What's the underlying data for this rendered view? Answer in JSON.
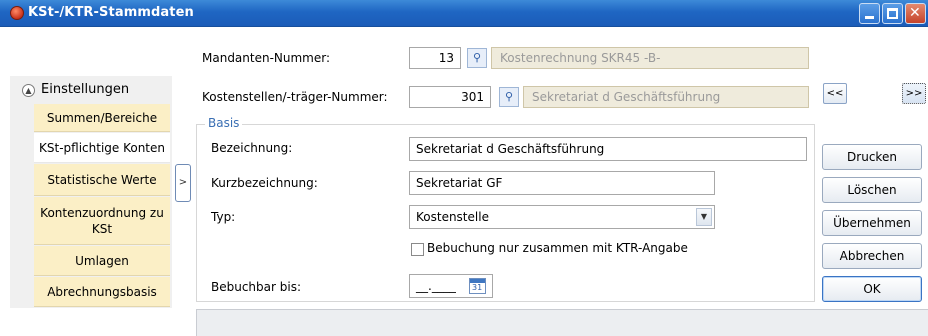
{
  "window": {
    "title": "KSt-/KTR-Stammdaten"
  },
  "sidebar": {
    "header_label": "Einstellungen",
    "items": [
      {
        "label": "Summen/Bereiche"
      },
      {
        "label": "KSt-pflichtige Konten"
      },
      {
        "label": "Statistische Werte"
      },
      {
        "label": "Kontenzuordnung zu KSt"
      },
      {
        "label": "Umlagen"
      },
      {
        "label": "Abrechnungsbasis"
      }
    ],
    "toggle_label": ">"
  },
  "header_fields": {
    "mandant_label": "Mandanten-Nummer:",
    "mandant_value": "13",
    "mandant_name": "Kostenrechnung SKR45 -B-",
    "kst_label": "Kostenstellen/-träger-Nummer:",
    "kst_value": "301",
    "kst_name": "Sekretariat d Geschäftsführung"
  },
  "basis": {
    "group_title": "Basis",
    "bezeichnung_label": "Bezeichnung:",
    "bezeichnung_value": "Sekretariat d Geschäftsführung",
    "kurz_label": "Kurzbezeichnung:",
    "kurz_value": "Sekretariat GF",
    "typ_label": "Typ:",
    "typ_value": "Kostenstelle",
    "checkbox_label": "Bebuchung nur zusammen mit KTR-Angabe",
    "checkbox_checked": false,
    "bebuchbar_label": "Bebuchbar bis:",
    "bebuchbar_value": "__.____",
    "calendar_day": "31"
  },
  "nav": {
    "prev_label": "<<",
    "next_label": ">>"
  },
  "actions": {
    "print": "Drucken",
    "delete": "Löschen",
    "apply": "Übernehmen",
    "cancel": "Abbrechen",
    "ok": "OK"
  },
  "icons": {
    "app": "app-icon",
    "search": "binoculars-icon",
    "calendar": "calendar-icon",
    "select": "chevron-down-icon"
  }
}
